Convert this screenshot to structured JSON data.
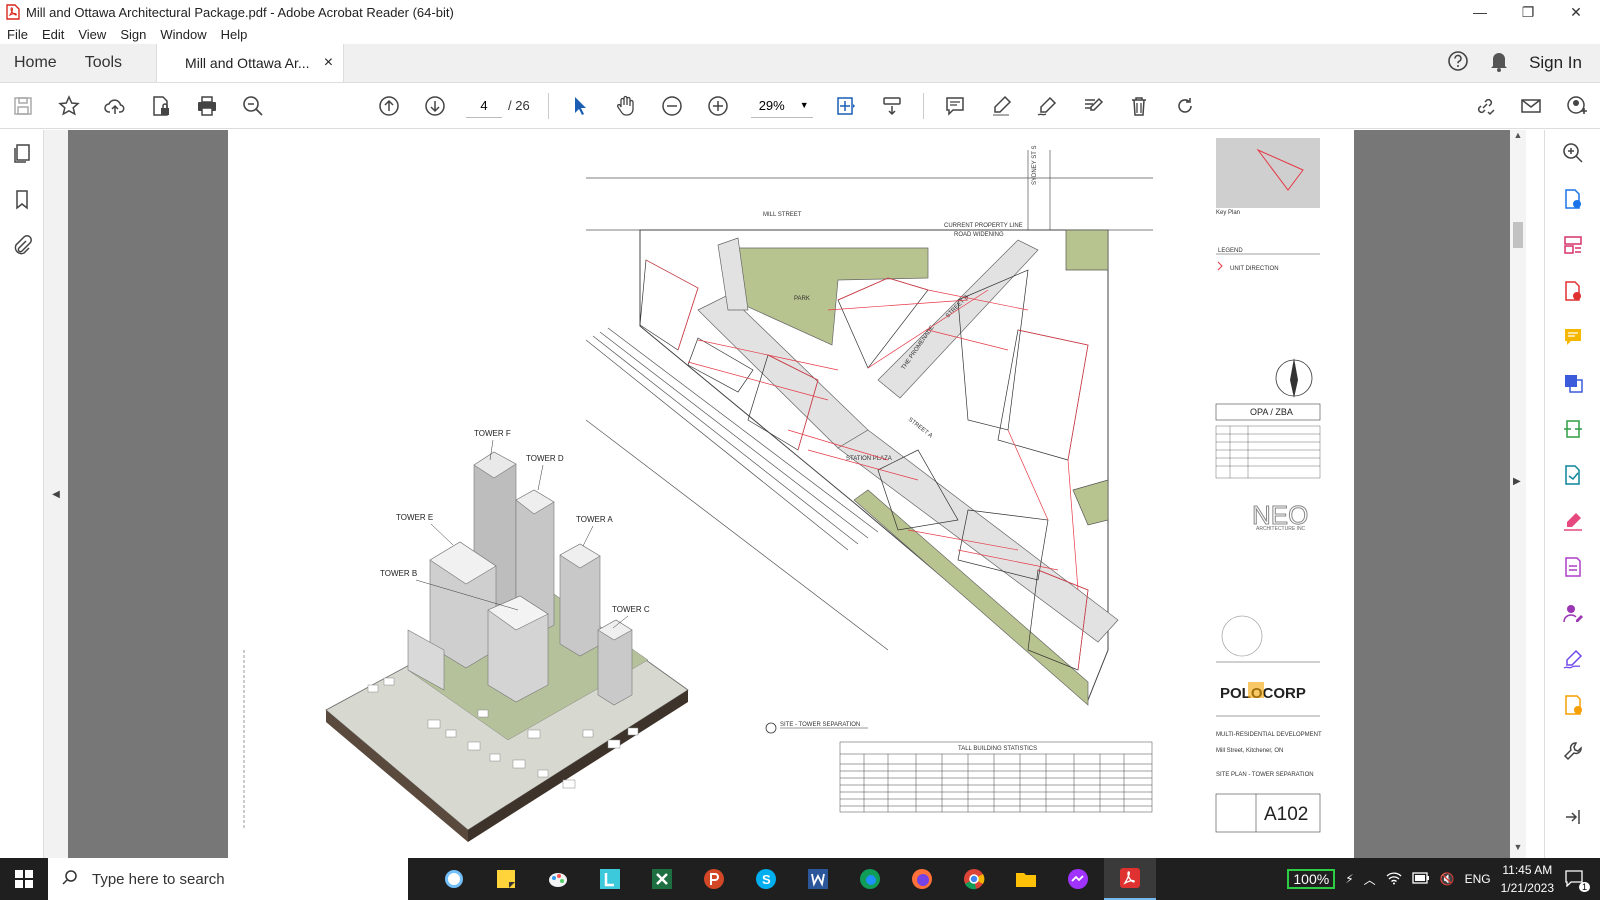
{
  "window": {
    "title": "Mill and Ottawa Architectural Package.pdf - Adobe Acrobat Reader (64-bit)",
    "minimize": "—",
    "restore": "❐",
    "close": "✕"
  },
  "menu": [
    "File",
    "Edit",
    "View",
    "Sign",
    "Window",
    "Help"
  ],
  "tabs": {
    "home": "Home",
    "tools": "Tools",
    "doc": "Mill and Ottawa Ar...",
    "doc_close": "×",
    "signin": "Sign In"
  },
  "toolbar": {
    "page_current": "4",
    "page_total": "/ 26",
    "zoom": "29%"
  },
  "drawing": {
    "street_mill": "MILL STREET",
    "street_sydney": "SYDNEY ST S",
    "property_line": "CURRENT PROPERTY LINE",
    "road_widening": "ROAD WIDENING",
    "park": "PARK",
    "station_plaza": "STATION PLAZA",
    "promenade": "THE PROMENADE",
    "street_a": "STREET A",
    "street_b": "STREET B",
    "towers": [
      "TOWER F",
      "TOWER D",
      "TOWER E",
      "TOWER A",
      "TOWER B",
      "TOWER C"
    ],
    "detail_title": "SITE - TOWER SEPARATION",
    "table_title": "TALL BUILDING STATISTICS"
  },
  "titleblock": {
    "key_plan": "Key Plan",
    "legend": "LEGEND",
    "legend_item": "UNIT DIRECTION",
    "opa": "OPA / ZBA",
    "firm": "NEO",
    "firm_sub": "ARCHITECTURE INC",
    "client": "POLOCORP",
    "project": "MULTI-RESIDENTIAL DEVELOPMENT",
    "address": "Mill Street, Kitchener, ON",
    "sheet_title": "SITE PLAN - TOWER SEPARATION",
    "sheet_no": "A102"
  },
  "taskbar": {
    "search_placeholder": "Type here to search",
    "battery": "100%",
    "lang": "ENG",
    "time": "11:45 AM",
    "date": "1/21/2023",
    "notif": "1"
  }
}
